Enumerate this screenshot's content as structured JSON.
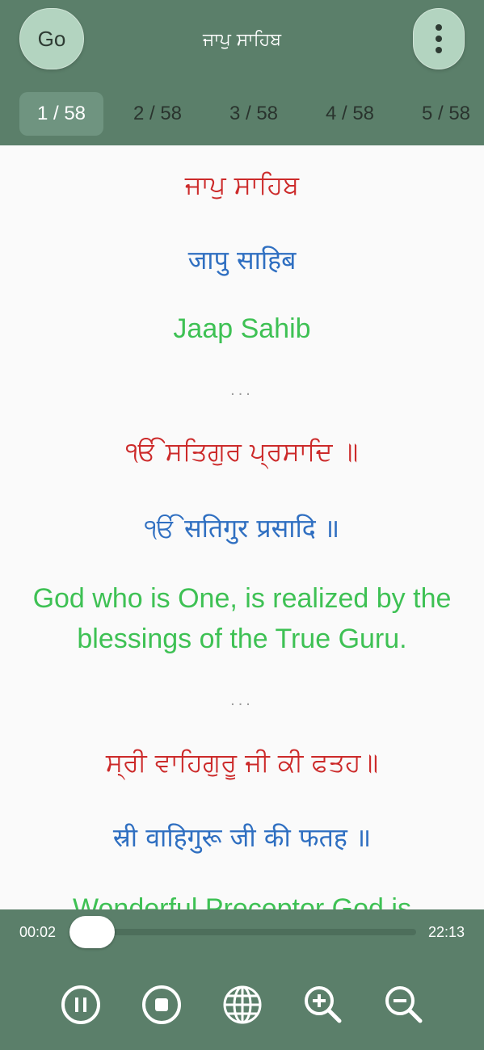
{
  "header": {
    "go_label": "Go",
    "title": "ਜਾਪੁ ਸਾਹਿਬ",
    "menu_icon": "more-vertical-icon"
  },
  "tabs": [
    {
      "label": "1 / 58",
      "active": true
    },
    {
      "label": "2 / 58",
      "active": false
    },
    {
      "label": "3 / 58",
      "active": false
    },
    {
      "label": "4 / 58",
      "active": false
    },
    {
      "label": "5 / 58",
      "active": false
    }
  ],
  "content": {
    "blocks": [
      {
        "gurmukhi": "ਜਾਪੁ ਸਾਹਿਬ",
        "hindi": "जापु साहिब",
        "english": "Jaap Sahib"
      },
      {
        "gurmukhi": "ੴ ਸਤਿਗੁਰ ਪ੍ਰਸਾਦਿ ॥",
        "hindi": "ੴ सतिगुर प्रसादि ॥",
        "english": "God who is One, is realized by the blessings of the True Guru."
      },
      {
        "gurmukhi": "ਸ੍ਰੀ ਵਾਹਿਗੁਰੂ ਜੀ ਕੀ ਫਤਹ॥",
        "hindi": "स्री वाहिगुरू जी की फतह ॥",
        "english": "Wonderful Preceptor God is"
      }
    ],
    "separator": "..."
  },
  "player": {
    "elapsed": "00:02",
    "total": "22:13",
    "progress": 0.0015,
    "controls": [
      "pause-icon",
      "stop-icon",
      "globe-icon",
      "zoom-in-icon",
      "zoom-out-icon"
    ]
  },
  "colors": {
    "header_bg": "#5b7f6a",
    "button_bg": "#b3d4c0",
    "gurmukhi": "#cc2a2a",
    "hindi": "#2f6fc1",
    "english": "#3ec154"
  }
}
